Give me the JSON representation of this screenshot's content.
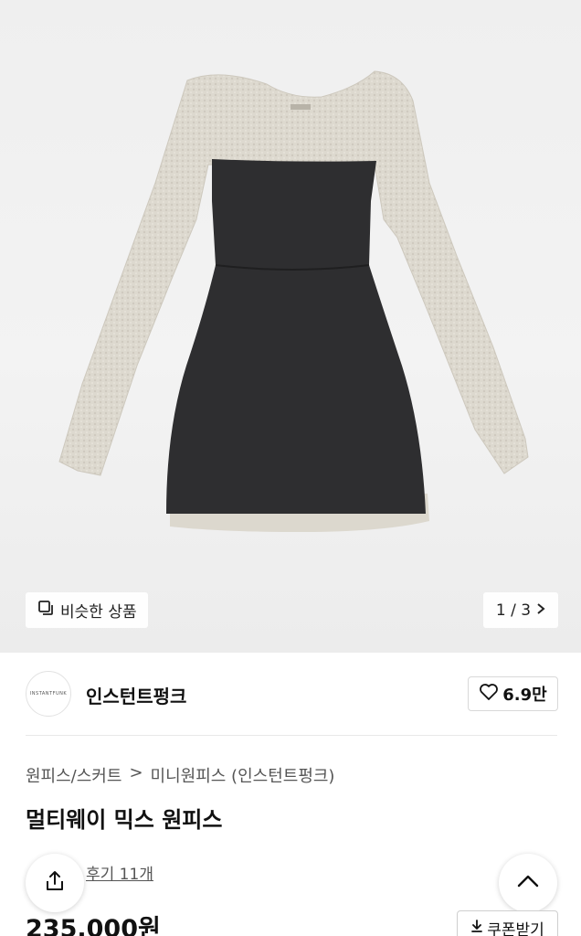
{
  "gallery": {
    "similar_label": "비슷한 상품",
    "pager_text": "1 / 3"
  },
  "brand": {
    "logo_text": "INSTANTFUNK",
    "name": "인스턴트펑크",
    "likes": "6.9만"
  },
  "product": {
    "breadcrumb": [
      "원피스/스커트",
      ">",
      "미니원피스 (인스턴트펑크)"
    ],
    "title": "멀티웨이 믹스 원피스",
    "review_link": "후기 11개",
    "price": "235,000원",
    "coupon_label": "쿠폰받기"
  },
  "icons": {
    "similar": "copy-icon",
    "pager": "chevron-right-icon",
    "like": "heart-icon",
    "share": "share-icon",
    "scroll_top": "chevron-up-icon",
    "coupon": "download-icon"
  }
}
